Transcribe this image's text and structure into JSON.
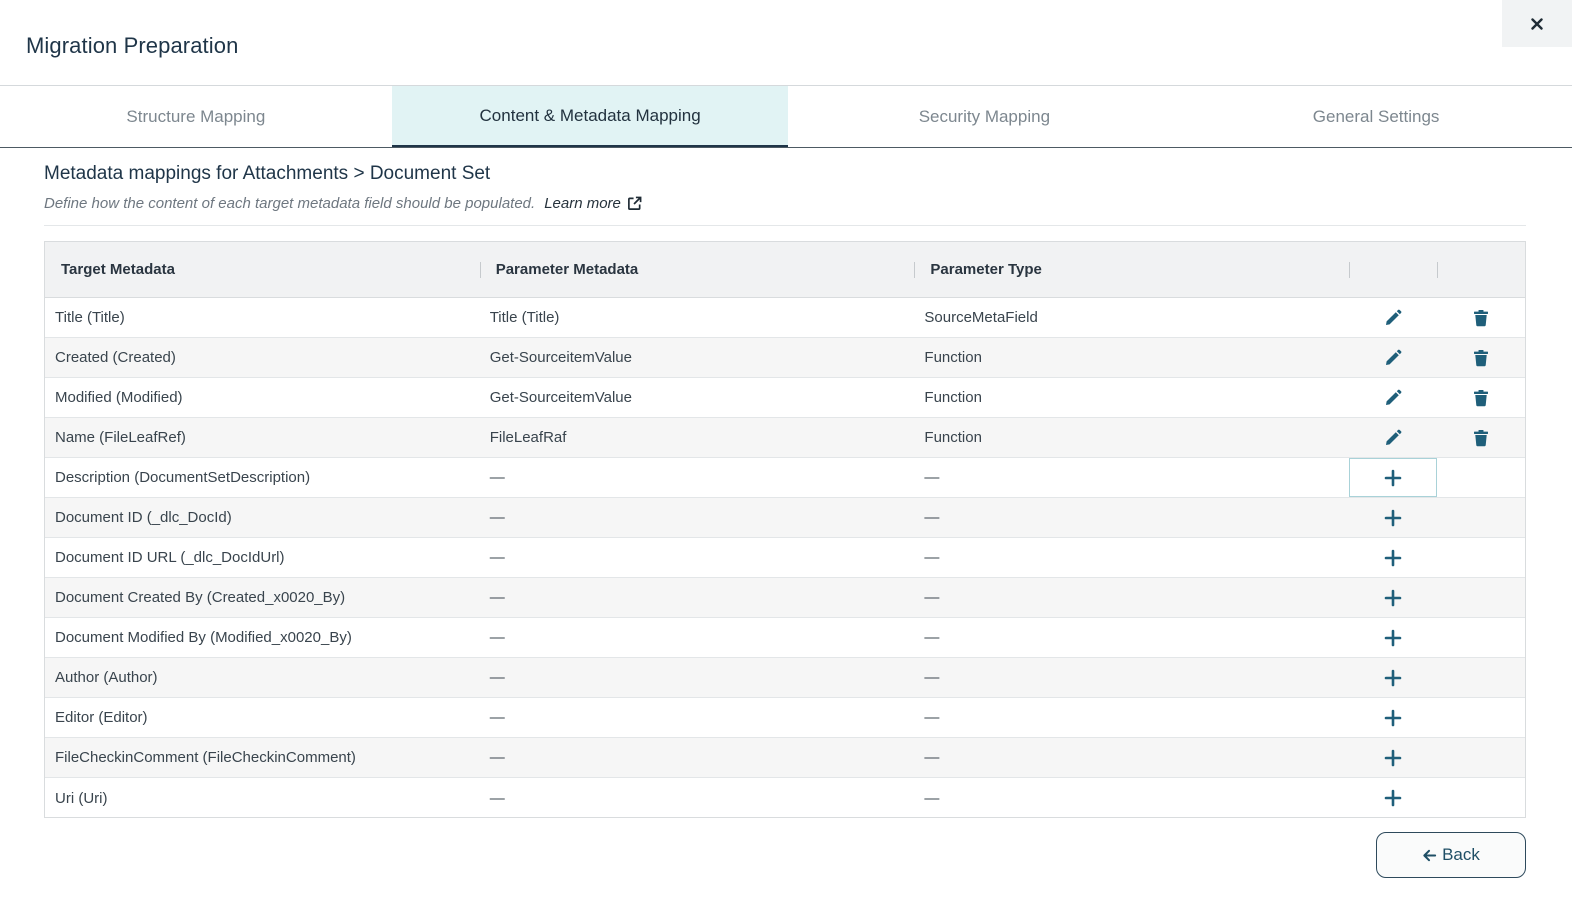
{
  "dialog": {
    "title": "Migration Preparation",
    "close_icon": "close-icon"
  },
  "tabs": [
    {
      "label": "Structure Mapping",
      "active": false
    },
    {
      "label": "Content & Metadata Mapping",
      "active": true
    },
    {
      "label": "Security Mapping",
      "active": false
    },
    {
      "label": "General Settings",
      "active": false
    }
  ],
  "section": {
    "title": "Metadata mappings for Attachments > Document Set",
    "description": "Define how the content of each target metadata field should be populated.",
    "learn_more": "Learn more"
  },
  "table": {
    "headers": [
      "Target Metadata",
      "Parameter Metadata",
      "Parameter Type",
      "",
      ""
    ],
    "rows": [
      {
        "target": "Title (Title)",
        "param": "Title (Title)",
        "type": "SourceMetaField",
        "mapped": true
      },
      {
        "target": "Created (Created)",
        "param": "Get-SourceitemValue",
        "type": "Function",
        "mapped": true
      },
      {
        "target": "Modified (Modified)",
        "param": "Get-SourceitemValue",
        "type": "Function",
        "mapped": true
      },
      {
        "target": "Name (FileLeafRef)",
        "param": "FileLeafRaf",
        "type": "Function",
        "mapped": true
      },
      {
        "target": "Description (DocumentSetDescription)",
        "param": "—",
        "type": "—",
        "mapped": false
      },
      {
        "target": "Document ID (_dlc_DocId)",
        "param": "—",
        "type": "—",
        "mapped": false
      },
      {
        "target": "Document ID URL (_dlc_DocIdUrl)",
        "param": "—",
        "type": "—",
        "mapped": false
      },
      {
        "target": "Document Created By (Created_x0020_By)",
        "param": "—",
        "type": "—",
        "mapped": false
      },
      {
        "target": "Document Modified By (Modified_x0020_By)",
        "param": "—",
        "type": "—",
        "mapped": false
      },
      {
        "target": "Author (Author)",
        "param": "—",
        "type": "—",
        "mapped": false
      },
      {
        "target": "Editor (Editor)",
        "param": "—",
        "type": "—",
        "mapped": false
      },
      {
        "target": "FileCheckinComment (FileCheckinComment)",
        "param": "—",
        "type": "—",
        "mapped": false
      },
      {
        "target": "Uri (Uri)",
        "param": "—",
        "type": "—",
        "mapped": false
      }
    ]
  },
  "footer": {
    "back_label": "Back"
  },
  "colors": {
    "accent": "#1f5f7a",
    "active_tab_bg": "#e1f3f4",
    "title": "#1f3548"
  }
}
